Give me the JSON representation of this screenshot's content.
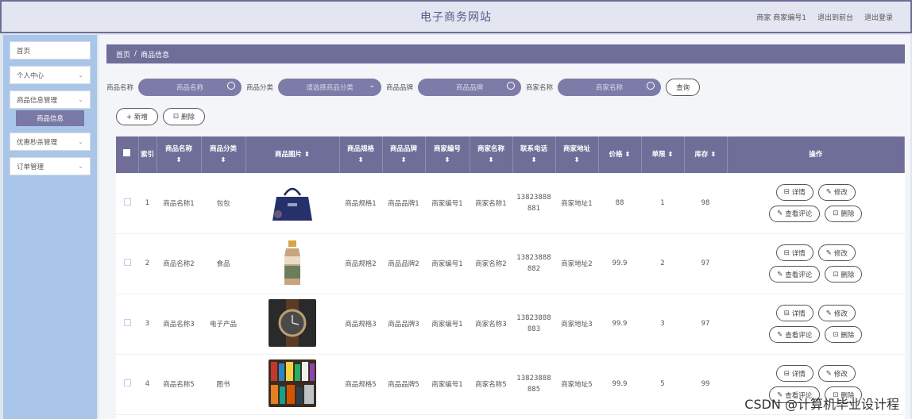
{
  "header": {
    "title": "电子商务网站",
    "links": [
      "商家 商家编号1",
      "退出到前台",
      "退出登录"
    ]
  },
  "sidebar": {
    "items": [
      {
        "label": "首页",
        "chevron": false
      },
      {
        "label": "个人中心",
        "chevron": true
      },
      {
        "label": "商品信息管理",
        "chevron": true
      },
      {
        "label": "优惠秒杀管理",
        "chevron": true
      },
      {
        "label": "订单管理",
        "chevron": true
      }
    ],
    "active_sub": "商品信息"
  },
  "breadcrumb": {
    "home": "首页",
    "sep": "/",
    "current": "商品信息"
  },
  "search": {
    "fields": [
      {
        "label": "商品名称",
        "placeholder": "商品名称",
        "kind": "text"
      },
      {
        "label": "商品分类",
        "placeholder": "请选择商品分类",
        "kind": "select"
      },
      {
        "label": "商品品牌",
        "placeholder": "商品品牌",
        "kind": "text"
      },
      {
        "label": "商家名称",
        "placeholder": "商家名称",
        "kind": "text"
      }
    ],
    "query_label": "查询"
  },
  "toolbar": {
    "add_label": "+ 新增",
    "delete_label": "删除"
  },
  "table": {
    "columns": [
      "索引",
      "商品名称",
      "商品分类",
      "商品图片",
      "商品规格",
      "商品品牌",
      "商家编号",
      "商家名称",
      "联系电话",
      "商家地址",
      "价格",
      "单限",
      "库存",
      "操作"
    ],
    "rows": [
      {
        "index": "1",
        "name": "商品名称1",
        "category": "包包",
        "image": "handbag",
        "spec": "商品规格1",
        "brand": "商品品牌1",
        "merchant_no": "商家编号1",
        "merchant_name": "商家名称1",
        "phone": "13823888881",
        "address": "商家地址1",
        "price": "88",
        "limit": "1",
        "stock": "98"
      },
      {
        "index": "2",
        "name": "商品名称2",
        "category": "食品",
        "image": "bottle",
        "spec": "商品规格2",
        "brand": "商品品牌2",
        "merchant_no": "商家编号1",
        "merchant_name": "商家名称2",
        "phone": "13823888882",
        "address": "商家地址2",
        "price": "99.9",
        "limit": "2",
        "stock": "97"
      },
      {
        "index": "3",
        "name": "商品名称3",
        "category": "电子产品",
        "image": "watch",
        "spec": "商品规格3",
        "brand": "商品品牌3",
        "merchant_no": "商家编号1",
        "merchant_name": "商家名称3",
        "phone": "13823888883",
        "address": "商家地址3",
        "price": "99.9",
        "limit": "3",
        "stock": "97"
      },
      {
        "index": "4",
        "name": "商品名称5",
        "category": "图书",
        "image": "books",
        "spec": "商品规格5",
        "brand": "商品品牌5",
        "merchant_no": "商家编号1",
        "merchant_name": "商家名称5",
        "phone": "13823888885",
        "address": "商家地址5",
        "price": "99.9",
        "limit": "5",
        "stock": "99"
      }
    ],
    "ops": {
      "detail": "详情",
      "edit": "修改",
      "comments": "查看评论",
      "delete": "删除"
    }
  },
  "watermark": "CSDN @计算机毕业设计程"
}
